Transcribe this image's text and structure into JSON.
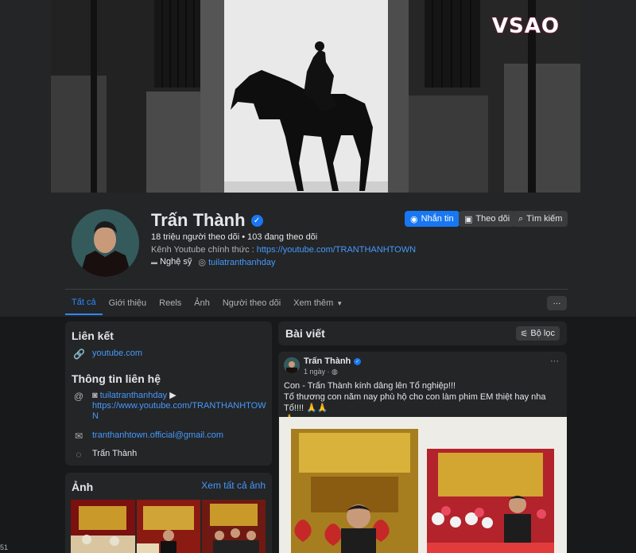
{
  "watermark": "VSAO",
  "profile": {
    "name": "Trấn Thành",
    "stats": "18 triệu người theo dõi • 103 đang theo dõi",
    "desc_prefix": "Kênh Youtube chính thức : ",
    "desc_link": "https://youtube.com/TRANTHANHTOWN",
    "tag_category": "Nghệ sỹ",
    "tag_handle": "tuilatranthanhday"
  },
  "actions": {
    "message": "Nhắn tin",
    "follow": "Theo dõi",
    "search": "Tìm kiếm"
  },
  "tabs": [
    "Tất cả",
    "Giới thiệu",
    "Reels",
    "Ảnh",
    "Người theo dõi",
    "Xem thêm"
  ],
  "more_button": "···",
  "links_card": {
    "title": "Liên kết",
    "youtube": "youtube.com"
  },
  "contact_card": {
    "title": "Thông tin liên hệ",
    "instagram": "tuilatranthanhday",
    "youtube_line1": "https://www.youtube.com/TRANTHANHTOW",
    "youtube_line2": "N",
    "email": "tranthanhtown.official@gmail.com",
    "messenger": "Trấn Thành"
  },
  "photos_card": {
    "title": "Ảnh",
    "see_all": "Xem tất cả ảnh"
  },
  "posts_card": {
    "title": "Bài viết",
    "filter": "Bộ lọc"
  },
  "post": {
    "author": "Trấn Thành",
    "time": "1 ngày · ",
    "more": "···",
    "line1": "Con - Trấn Thành kính dâng lên Tổ nghiệp!!!",
    "line2": "Tổ thương con năm nay phù hộ cho con làm phim EM thiệt hay nha Tổ!!!! 🙏🙏",
    "line3": "🙏"
  },
  "colors": {
    "accent": "#1877f2",
    "link": "#4599ff",
    "card": "#242526",
    "background": "#18191a"
  },
  "icons": {
    "link": "link-icon",
    "instagram": "instagram-icon",
    "youtube": "youtube-icon",
    "email": "mail-icon",
    "messenger": "messenger-icon",
    "verified": "verified-badge-icon"
  }
}
